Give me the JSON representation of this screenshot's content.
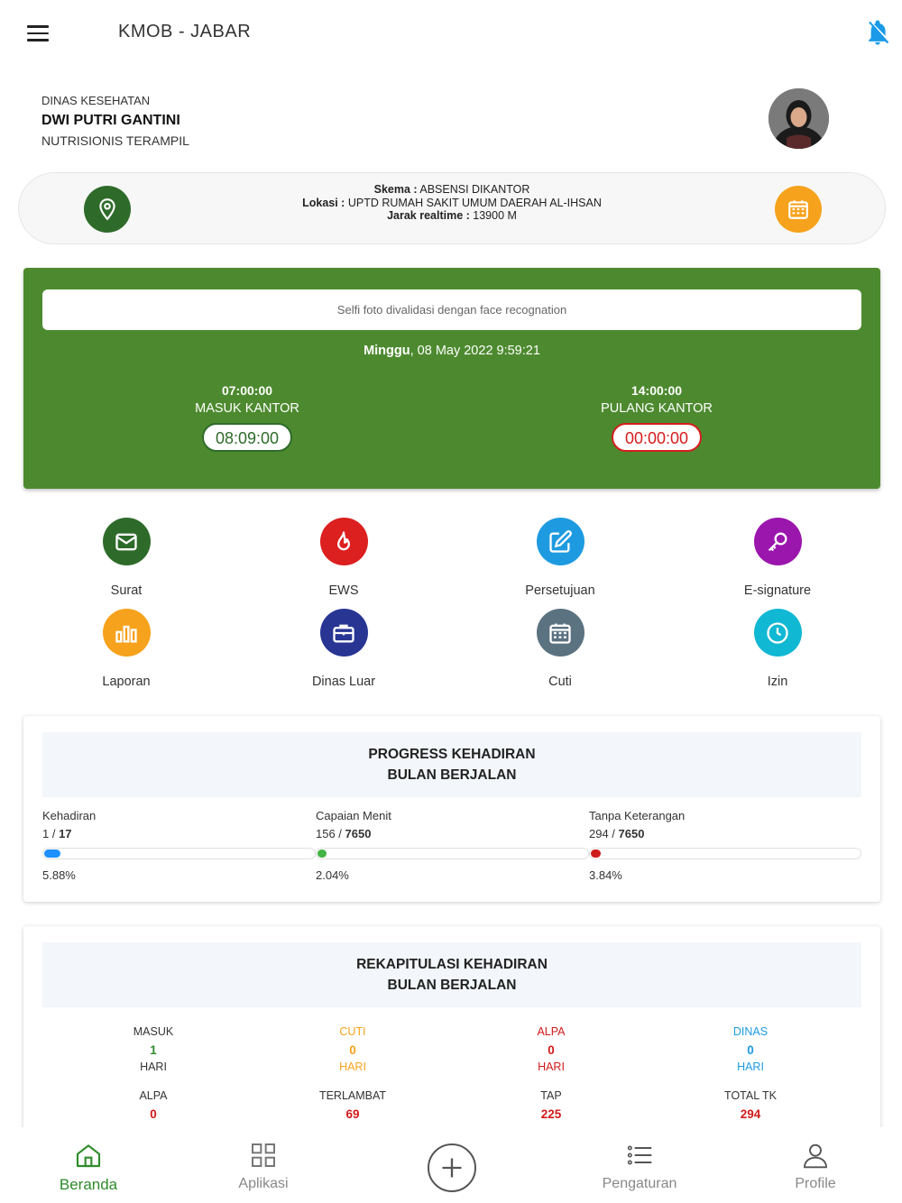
{
  "header": {
    "title": "KMOB - JABAR",
    "menu_icon": "hamburger-menu-icon",
    "notification_icon": "bell-off-icon",
    "accent": "#1a9ae8"
  },
  "profile": {
    "department": "DINAS KESEHATAN",
    "name": "DWI PUTRI GANTINI",
    "position": "NUTRISIONIS TERAMPIL"
  },
  "schema": {
    "skema_label": "Skema :",
    "skema_value": "ABSENSI DIKANTOR",
    "lokasi_label": "Lokasi :",
    "lokasi_value": "UPTD RUMAH SAKIT UMUM DAERAH AL-IHSAN",
    "jarak_label": "Jarak realtime :",
    "jarak_value": "13900 M"
  },
  "attendance": {
    "selfie_note": "Selfi foto divalidasi dengan face recognation",
    "day": "Minggu",
    "date_time": ", 08 May 2022 9:59:21",
    "in": {
      "time": "07:00:00",
      "label": "MASUK KANTOR",
      "actual": "08:09:00"
    },
    "out": {
      "time": "14:00:00",
      "label": "PULANG KANTOR",
      "actual": "00:00:00"
    },
    "card_color": "#4d8a2f"
  },
  "menu": [
    {
      "label": "Surat",
      "icon": "envelope-icon",
      "color": "#2e6b2a"
    },
    {
      "label": "EWS",
      "icon": "fire-icon",
      "color": "#dc1f1f"
    },
    {
      "label": "Persetujuan",
      "icon": "edit-icon",
      "color": "#1e9be0"
    },
    {
      "label": "E-signature",
      "icon": "key-icon",
      "color": "#9b16ad"
    },
    {
      "label": "Laporan",
      "icon": "bar-chart-icon",
      "color": "#f6a21c"
    },
    {
      "label": "Dinas Luar",
      "icon": "briefcase-icon",
      "color": "#283593"
    },
    {
      "label": "Cuti",
      "icon": "calendar-icon",
      "color": "#5b7280"
    },
    {
      "label": "Izin",
      "icon": "clock-icon",
      "color": "#11b8d4"
    }
  ],
  "progress": {
    "title_line1": "PROGRESS KEHADIRAN",
    "title_line2": "BULAN BERJALAN",
    "items": [
      {
        "label": "Kehadiran",
        "current": "1 / ",
        "total": "17",
        "percent_text": "5.88%",
        "fraction": 0.0588,
        "color": "#1e90ff"
      },
      {
        "label": "Capaian Menit",
        "current": "156 / ",
        "total": "7650",
        "percent_text": "2.04%",
        "fraction": 0.0204,
        "color": "#43b343"
      },
      {
        "label": "Tanpa Keterangan",
        "current": "294 / ",
        "total": "7650",
        "percent_text": "3.84%",
        "fraction": 0.0384,
        "color": "#d11a1a"
      }
    ]
  },
  "rekap": {
    "title_line1": "REKAPITULASI KEHADIRAN",
    "title_line2": "BULAN BERJALAN",
    "row1": [
      {
        "label": "MASUK",
        "value": "1",
        "unit": "HARI",
        "label_color": "#333",
        "value_color": "#2e8b2a"
      },
      {
        "label": "CUTI",
        "value": "0",
        "unit": "HARI",
        "label_color": "#f6a21c",
        "value_color": "#f6a21c"
      },
      {
        "label": "ALPA",
        "value": "0",
        "unit": "HARI",
        "label_color": "#d11a1a",
        "value_color": "#d11a1a"
      },
      {
        "label": "DINAS",
        "value": "0",
        "unit": "HARI",
        "label_color": "#1e9be0",
        "value_color": "#1e9be0"
      }
    ],
    "row2": [
      {
        "label": "ALPA",
        "value": "0"
      },
      {
        "label": "TERLAMBAT",
        "value": "69"
      },
      {
        "label": "TAP",
        "value": "225"
      },
      {
        "label": "TOTAL TK",
        "value": "294"
      }
    ]
  },
  "bottom_nav": {
    "items": [
      {
        "label": "Beranda",
        "icon": "home-icon",
        "active": true
      },
      {
        "label": "Aplikasi",
        "icon": "grid-icon",
        "active": false
      },
      {
        "label": "Pengaturan",
        "icon": "list-icon",
        "active": false
      },
      {
        "label": "Profile",
        "icon": "user-icon",
        "active": false
      }
    ],
    "add_icon": "plus-circle-icon"
  }
}
